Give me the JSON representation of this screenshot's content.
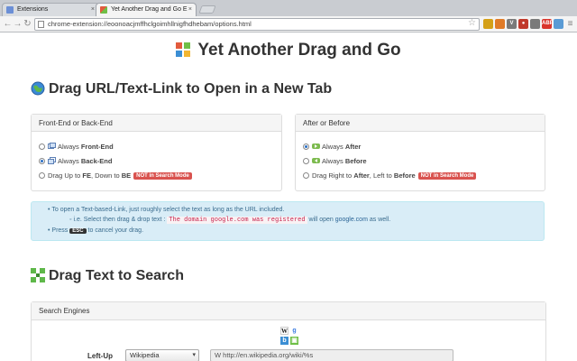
{
  "browser": {
    "tabs": [
      {
        "title": "Extensions",
        "close": "×"
      },
      {
        "title": "Yet Another Drag and Go E",
        "close": "×"
      }
    ],
    "nav": {
      "back": "←",
      "forward": "→",
      "reload": "↻"
    },
    "address": "chrome-extension://eoonoacjmffhclgoimhllnigfhdhebam/options.html",
    "bookmark_star": "☆",
    "extensions": [
      {
        "icon": "chrome-icon",
        "color": "#d4a017",
        "glyph": ""
      },
      {
        "icon": "fox-icon",
        "color": "#e07b28",
        "glyph": ""
      },
      {
        "icon": "v-icon",
        "color": "#7a7a7a",
        "glyph": "V"
      },
      {
        "icon": "shield-icon",
        "color": "#c0392b",
        "glyph": "●"
      },
      {
        "icon": "globe-icon",
        "color": "#7a7a7a",
        "glyph": ""
      },
      {
        "icon": "adblock-icon",
        "color": "#d9342b",
        "glyph": "ABP"
      },
      {
        "icon": "drag-go-icon",
        "color": "#5a9bd5",
        "glyph": ""
      },
      {
        "icon": "menu-icon",
        "color": "#777",
        "glyph": "≡"
      }
    ]
  },
  "page": {
    "title": "Yet Another Drag and Go",
    "link_section": {
      "title": "Drag URL/Text-Link to Open in a New Tab",
      "front_back": {
        "heading": "Front-End or Back-End",
        "options": [
          {
            "prefix": "Always ",
            "bold": "Front-End",
            "suffix": "",
            "checked": false
          },
          {
            "prefix": "Always ",
            "bold": "Back-End",
            "suffix": "",
            "checked": true
          }
        ],
        "dir_option": {
          "p1": "Drag Up to ",
          "b1": "FE",
          "p2": ", Down to ",
          "b2": "BE",
          "badge": "NOT in Search Mode"
        }
      },
      "after_before": {
        "heading": "After or Before",
        "options": [
          {
            "prefix": "Always ",
            "bold": "After",
            "suffix": "",
            "checked": true
          },
          {
            "prefix": "Always ",
            "bold": "Before",
            "suffix": "",
            "checked": false
          }
        ],
        "dir_option": {
          "p1": "Drag Right to ",
          "b1": "After",
          "p2": ", Left to ",
          "b2": "Before",
          "badge": "NOT in Search Mode"
        }
      }
    },
    "info": {
      "line1": "To open a Text-based-Link, just roughly select the text as long as the URL included.",
      "line2_prefix": "i.e. Select then drag & drop text :",
      "line2_code": "The domain google.com was registered",
      "line2_mid": " will open ",
      "line2_link": "google.com",
      "line2_suffix": " as well.",
      "line3_prefix": "Press ",
      "line3_key": "ESC",
      "line3_suffix": " to cancel your drag."
    },
    "search_section": {
      "title": "Drag Text to Search",
      "panel_heading": "Search Engines",
      "row_label": "Left-Up",
      "engine_value": "Wikipedia",
      "url_value": "W http://en.wikipedia.org/wiki/%s",
      "mini_icons": [
        {
          "icon": "wikipedia-icon",
          "glyph": "W"
        },
        {
          "icon": "google-icon",
          "glyph": "g"
        },
        {
          "icon": "bing-icon",
          "glyph": "b"
        },
        {
          "icon": "map-icon",
          "glyph": "▣"
        }
      ]
    }
  }
}
